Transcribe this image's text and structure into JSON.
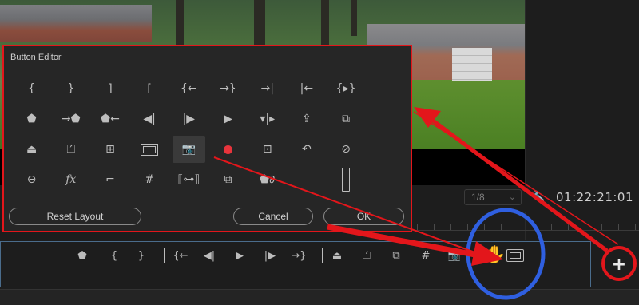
{
  "button_editor": {
    "title": "Button Editor",
    "icons": [
      {
        "name": "mark-in-icon",
        "glyph": "{"
      },
      {
        "name": "mark-out-icon",
        "glyph": "}"
      },
      {
        "name": "mark-clip-icon",
        "glyph": "⌉"
      },
      {
        "name": "go-to-in-icon",
        "glyph": "⌈"
      },
      {
        "name": "go-to-in-point-icon",
        "glyph": "{←"
      },
      {
        "name": "go-to-out-point-icon",
        "glyph": "→}"
      },
      {
        "name": "go-to-next-edit-icon",
        "glyph": "→|"
      },
      {
        "name": "go-to-previous-edit-icon",
        "glyph": "|←"
      },
      {
        "name": "play-in-to-out-icon",
        "glyph": "{▸}"
      },
      {
        "name": "empty-slot",
        "glyph": ""
      },
      {
        "name": "add-marker-icon",
        "glyph": "⬟"
      },
      {
        "name": "go-to-next-marker-icon",
        "glyph": "→⬟"
      },
      {
        "name": "go-to-previous-marker-icon",
        "glyph": "⬟←"
      },
      {
        "name": "step-back-icon",
        "glyph": "◀|"
      },
      {
        "name": "step-forward-icon",
        "glyph": "|▶"
      },
      {
        "name": "play-icon",
        "glyph": "▶"
      },
      {
        "name": "shuttle-icon",
        "glyph": "▾|▸"
      },
      {
        "name": "export-frame-share-icon",
        "glyph": "⇪"
      },
      {
        "name": "overwrite-icon",
        "glyph": "⧉"
      },
      {
        "name": "empty-slot",
        "glyph": ""
      },
      {
        "name": "lift-icon",
        "glyph": "⏏"
      },
      {
        "name": "extract-icon",
        "glyph": "⏍"
      },
      {
        "name": "insert-icon",
        "glyph": "⊞"
      },
      {
        "name": "safe-margins-icon",
        "glyph": "frame"
      },
      {
        "name": "camera-icon",
        "glyph": "📷"
      },
      {
        "name": "record-icon",
        "glyph": "rec"
      },
      {
        "name": "multi-camera-icon",
        "glyph": "⊡"
      },
      {
        "name": "loop-icon",
        "glyph": "↶"
      },
      {
        "name": "toggle-proxies-icon",
        "glyph": "⊘"
      },
      {
        "name": "empty-slot",
        "glyph": ""
      },
      {
        "name": "vr-video-icon",
        "glyph": "⊖"
      },
      {
        "name": "fx-icon",
        "glyph": "fx"
      },
      {
        "name": "show-rulers-icon",
        "glyph": "⌐"
      },
      {
        "name": "show-guides-icon",
        "glyph": "#"
      },
      {
        "name": "snap-in-program-icon",
        "glyph": "⟦⊶⟧"
      },
      {
        "name": "comparison-view-icon",
        "glyph": "⧉"
      },
      {
        "name": "global-fx-mute-icon",
        "glyph": "⬟∂"
      },
      {
        "name": "empty-slot",
        "glyph": ""
      },
      {
        "name": "spacer-icon",
        "glyph": "tall"
      },
      {
        "name": "empty-slot",
        "glyph": ""
      }
    ],
    "reset_label": "Reset Layout",
    "cancel_label": "Cancel",
    "ok_label": "OK"
  },
  "monitor": {
    "zoom": "1/8",
    "timecode": "01:22:21:01"
  },
  "transport": {
    "buttons": [
      {
        "name": "add-marker-icon",
        "glyph": "⬟"
      },
      {
        "name": "mark-in-icon",
        "glyph": "{"
      },
      {
        "name": "mark-out-icon",
        "glyph": "}"
      },
      {
        "name": "spacer-icon",
        "glyph": "bar"
      },
      {
        "name": "go-to-in-icon",
        "glyph": "{←"
      },
      {
        "name": "step-back-icon",
        "glyph": "◀|"
      },
      {
        "name": "play-icon",
        "glyph": "▶"
      },
      {
        "name": "step-forward-icon",
        "glyph": "|▶"
      },
      {
        "name": "go-to-out-icon",
        "glyph": "→}"
      },
      {
        "name": "spacer-icon",
        "glyph": "bar"
      },
      {
        "name": "lift-icon",
        "glyph": "⏏"
      },
      {
        "name": "extract-icon",
        "glyph": "⏍"
      },
      {
        "name": "comparison-view-icon",
        "glyph": "⧉"
      },
      {
        "name": "show-guides-icon",
        "glyph": "#"
      },
      {
        "name": "camera-icon",
        "glyph": "📷"
      },
      {
        "name": "safe-margins-icon",
        "glyph": "film"
      }
    ],
    "add_button": "+"
  },
  "annotation_colors": {
    "highlight": "#e3161b",
    "circle_blue": "#2f5fe0"
  }
}
